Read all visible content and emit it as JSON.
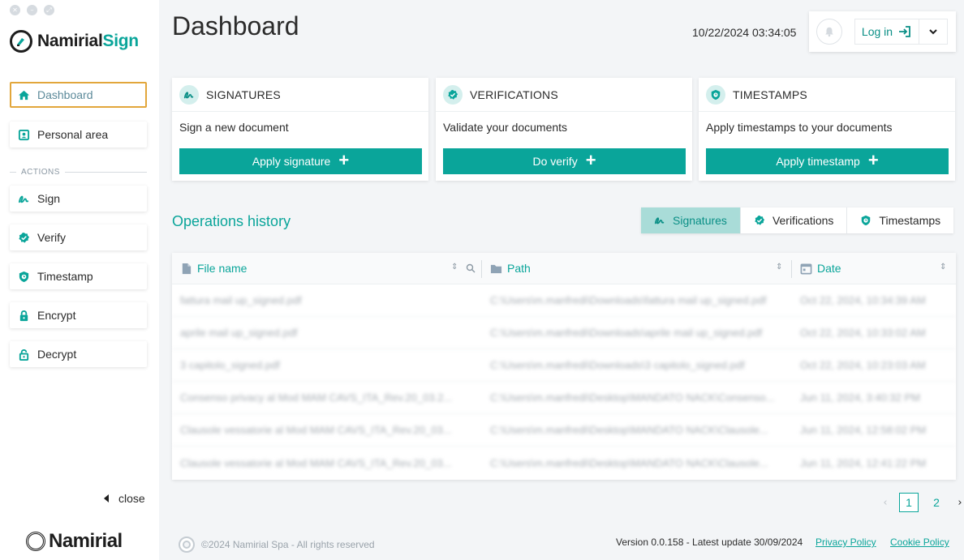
{
  "app": {
    "brand_main": "Namirial",
    "brand_accent": "Sign",
    "footer_logo": "Namirial"
  },
  "sidebar": {
    "items": [
      {
        "label": "Dashboard",
        "icon": "home-icon"
      },
      {
        "label": "Personal area",
        "icon": "id-card-icon"
      }
    ],
    "actions_label": "ACTIONS",
    "actions": [
      {
        "label": "Sign",
        "icon": "signature-icon"
      },
      {
        "label": "Verify",
        "icon": "verified-badge-icon"
      },
      {
        "label": "Timestamp",
        "icon": "shield-clock-icon"
      },
      {
        "label": "Encrypt",
        "icon": "lock-icon"
      },
      {
        "label": "Decrypt",
        "icon": "unlock-icon"
      }
    ],
    "close_label": "close"
  },
  "header": {
    "title": "Dashboard",
    "datetime": "10/22/2024 03:34:05",
    "login_label": "Log in"
  },
  "cards": [
    {
      "title": "SIGNATURES",
      "desc": "Sign a new document",
      "button": "Apply signature"
    },
    {
      "title": "VERIFICATIONS",
      "desc": "Validate your documents",
      "button": "Do verify"
    },
    {
      "title": "TIMESTAMPS",
      "desc": "Apply timestamps to your documents",
      "button": "Apply timestamp"
    }
  ],
  "history": {
    "title": "Operations history",
    "tabs": [
      "Signatures",
      "Verifications",
      "Timestamps"
    ],
    "columns": [
      "File name",
      "Path",
      "Date"
    ],
    "rows": [
      {
        "file": "fattura mail up_signed.pdf",
        "path": "C:\\Users\\m.manfredi\\Downloads\\fattura mail up_signed.pdf",
        "date": "Oct 22, 2024, 10:34:39 AM"
      },
      {
        "file": "aprile mail up_signed.pdf",
        "path": "C:\\Users\\m.manfredi\\Downloads\\aprile mail up_signed.pdf",
        "date": "Oct 22, 2024, 10:33:02 AM"
      },
      {
        "file": "3 capitolo_signed.pdf",
        "path": "C:\\Users\\m.manfredi\\Downloads\\3 capitolo_signed.pdf",
        "date": "Oct 22, 2024, 10:23:03 AM"
      },
      {
        "file": "Consenso privacy al Mod MAM CAVS_ITA_Rev.20_03.2...",
        "path": "C:\\Users\\m.manfredi\\Desktop\\MANDATO NACK\\Consenso...",
        "date": "Jun 11, 2024, 3:40:32 PM"
      },
      {
        "file": "Clausole vessatorie al Mod MAM CAVS_ITA_Rev.20_03...",
        "path": "C:\\Users\\m.manfredi\\Desktop\\MANDATO NACK\\Clausole...",
        "date": "Jun 11, 2024, 12:58:02 PM"
      },
      {
        "file": "Clausole vessatorie al Mod MAM CAVS_ITA_Rev.20_03...",
        "path": "C:\\Users\\m.manfredi\\Desktop\\MANDATO NACK\\Clausole...",
        "date": "Jun 11, 2024, 12:41:22 PM"
      }
    ],
    "pages": [
      "1",
      "2"
    ],
    "current_page": "1"
  },
  "footer": {
    "copyright": "©2024 Namirial Spa - All rights reserved",
    "version": "Version 0.0.158 - Latest update 30/09/2024",
    "privacy": "Privacy Policy",
    "cookie": "Cookie Policy"
  },
  "colors": {
    "accent": "#0aa59a",
    "active_border": "#e2a63b",
    "tab_active_bg": "#a9dcd8"
  }
}
